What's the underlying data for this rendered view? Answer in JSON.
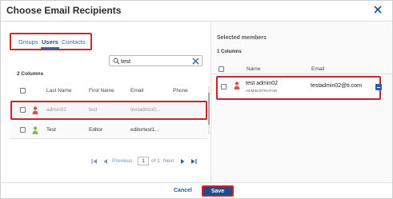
{
  "dialog": {
    "title": "Choose Email Recipients"
  },
  "tabs": [
    {
      "label": "Groups"
    },
    {
      "label": "Users"
    },
    {
      "label": "Contacts"
    }
  ],
  "search": {
    "value": "test"
  },
  "left_table": {
    "count_label": "2 Columns",
    "headers": [
      "Last Name",
      "First Name",
      "Email",
      "Phone"
    ],
    "rows": [
      {
        "last_name": "admin02",
        "first_name": "test",
        "email": "testadmin0...",
        "phone": "",
        "icon": "person-icon",
        "icon_color": "#e05050"
      },
      {
        "last_name": "Test",
        "first_name": "Editor",
        "email": "editortest1...",
        "phone": "",
        "icon": "person-icon",
        "icon_color": "#7cc04a"
      }
    ]
  },
  "pager": {
    "previous": "Previous",
    "page": "1",
    "of": "of 1",
    "next": "Next"
  },
  "selected": {
    "title": "Selected members",
    "count_label": "1 Columns",
    "headers": [
      "Name",
      "Email"
    ],
    "rows": [
      {
        "name": "test admin02",
        "role": "ADMINISTRATOR",
        "email": "testadmin02@ti.com",
        "icon": "person-icon",
        "icon_color": "#e05050"
      }
    ]
  },
  "footer": {
    "cancel_label": "Cancel",
    "save_label": "Save"
  },
  "colors": {
    "accent": "#1e4d8f",
    "highlight": "#c8242a",
    "link": "#1e6fb6"
  }
}
